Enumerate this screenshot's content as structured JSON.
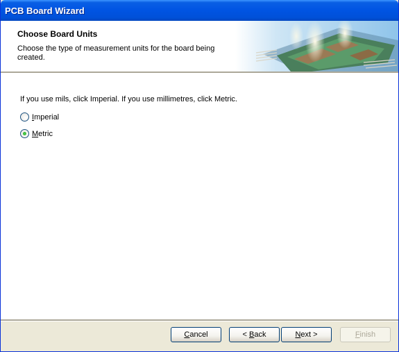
{
  "window": {
    "title": "PCB Board Wizard"
  },
  "header": {
    "title": "Choose Board Units",
    "description": "Choose the type of measurement units for the board being created."
  },
  "content": {
    "instruction": "If you use mils, click Imperial. If you use millimetres, click Metric.",
    "options": [
      {
        "accel": "I",
        "rest": "mperial",
        "checked": false
      },
      {
        "accel": "M",
        "rest": "etric",
        "checked": true
      }
    ]
  },
  "buttons": {
    "cancel": {
      "accel": "C",
      "rest": "ancel"
    },
    "back": {
      "prefix": "< ",
      "accel": "B",
      "rest": "ack"
    },
    "next": {
      "accel": "N",
      "rest": "ext >"
    },
    "finish": {
      "accel": "F",
      "rest": "inish"
    }
  }
}
